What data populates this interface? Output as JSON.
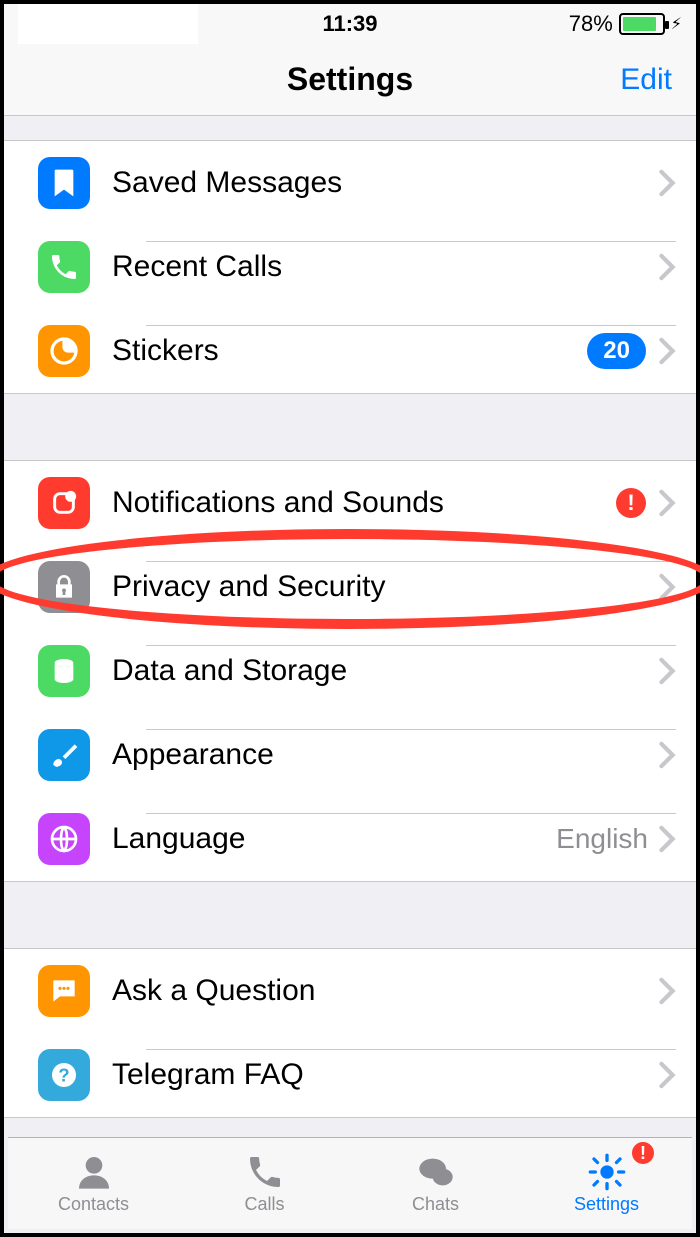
{
  "status": {
    "time": "11:39",
    "battery_pct": "78%"
  },
  "nav": {
    "title": "Settings",
    "edit": "Edit"
  },
  "sections": [
    {
      "rows": [
        {
          "icon": "bookmark",
          "color": "ic-blue",
          "label": "Saved Messages"
        },
        {
          "icon": "phone",
          "color": "ic-green",
          "label": "Recent Calls"
        },
        {
          "icon": "stickers",
          "color": "ic-orange",
          "label": "Stickers",
          "count": "20"
        }
      ]
    },
    {
      "rows": [
        {
          "icon": "bell",
          "color": "ic-red",
          "label": "Notifications and Sounds",
          "alert": "!"
        },
        {
          "icon": "lock",
          "color": "ic-gray",
          "label": "Privacy and Security"
        },
        {
          "icon": "disk",
          "color": "ic-green",
          "label": "Data and Storage"
        },
        {
          "icon": "brush",
          "color": "ic-paint",
          "label": "Appearance"
        },
        {
          "icon": "globe",
          "color": "ic-purple",
          "label": "Language",
          "detail": "English"
        }
      ]
    },
    {
      "rows": [
        {
          "icon": "chat",
          "color": "ic-orange",
          "label": "Ask a Question"
        },
        {
          "icon": "question",
          "color": "ic-lightblue",
          "label": "Telegram FAQ"
        }
      ]
    }
  ],
  "tabs": [
    {
      "icon": "contacts",
      "label": "Contacts"
    },
    {
      "icon": "calls",
      "label": "Calls"
    },
    {
      "icon": "chats",
      "label": "Chats"
    },
    {
      "icon": "settings",
      "label": "Settings",
      "active": true,
      "badge": "!"
    }
  ]
}
